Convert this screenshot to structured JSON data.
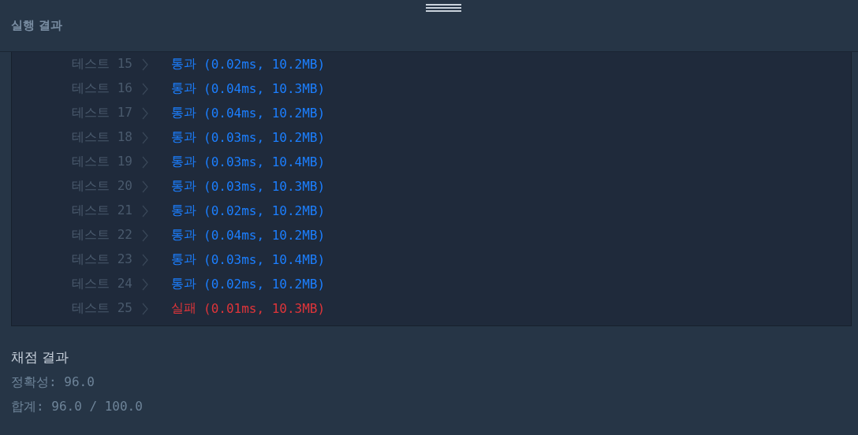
{
  "header": {
    "title": "실행 결과"
  },
  "tests": [
    {
      "label": "테스트 15",
      "kind": "pass",
      "verdict": "통과",
      "detail": "(0.02ms, 10.2MB)"
    },
    {
      "label": "테스트 16",
      "kind": "pass",
      "verdict": "통과",
      "detail": "(0.04ms, 10.3MB)"
    },
    {
      "label": "테스트 17",
      "kind": "pass",
      "verdict": "통과",
      "detail": "(0.04ms, 10.2MB)"
    },
    {
      "label": "테스트 18",
      "kind": "pass",
      "verdict": "통과",
      "detail": "(0.03ms, 10.2MB)"
    },
    {
      "label": "테스트 19",
      "kind": "pass",
      "verdict": "통과",
      "detail": "(0.03ms, 10.4MB)"
    },
    {
      "label": "테스트 20",
      "kind": "pass",
      "verdict": "통과",
      "detail": "(0.03ms, 10.3MB)"
    },
    {
      "label": "테스트 21",
      "kind": "pass",
      "verdict": "통과",
      "detail": "(0.02ms, 10.2MB)"
    },
    {
      "label": "테스트 22",
      "kind": "pass",
      "verdict": "통과",
      "detail": "(0.04ms, 10.2MB)"
    },
    {
      "label": "테스트 23",
      "kind": "pass",
      "verdict": "통과",
      "detail": "(0.03ms, 10.4MB)"
    },
    {
      "label": "테스트 24",
      "kind": "pass",
      "verdict": "통과",
      "detail": "(0.02ms, 10.2MB)"
    },
    {
      "label": "테스트 25",
      "kind": "fail",
      "verdict": "실패",
      "detail": "(0.01ms, 10.3MB)"
    }
  ],
  "grading": {
    "title": "채점 결과",
    "lines": [
      "정확성: 96.0",
      "합계: 96.0 / 100.0"
    ]
  }
}
